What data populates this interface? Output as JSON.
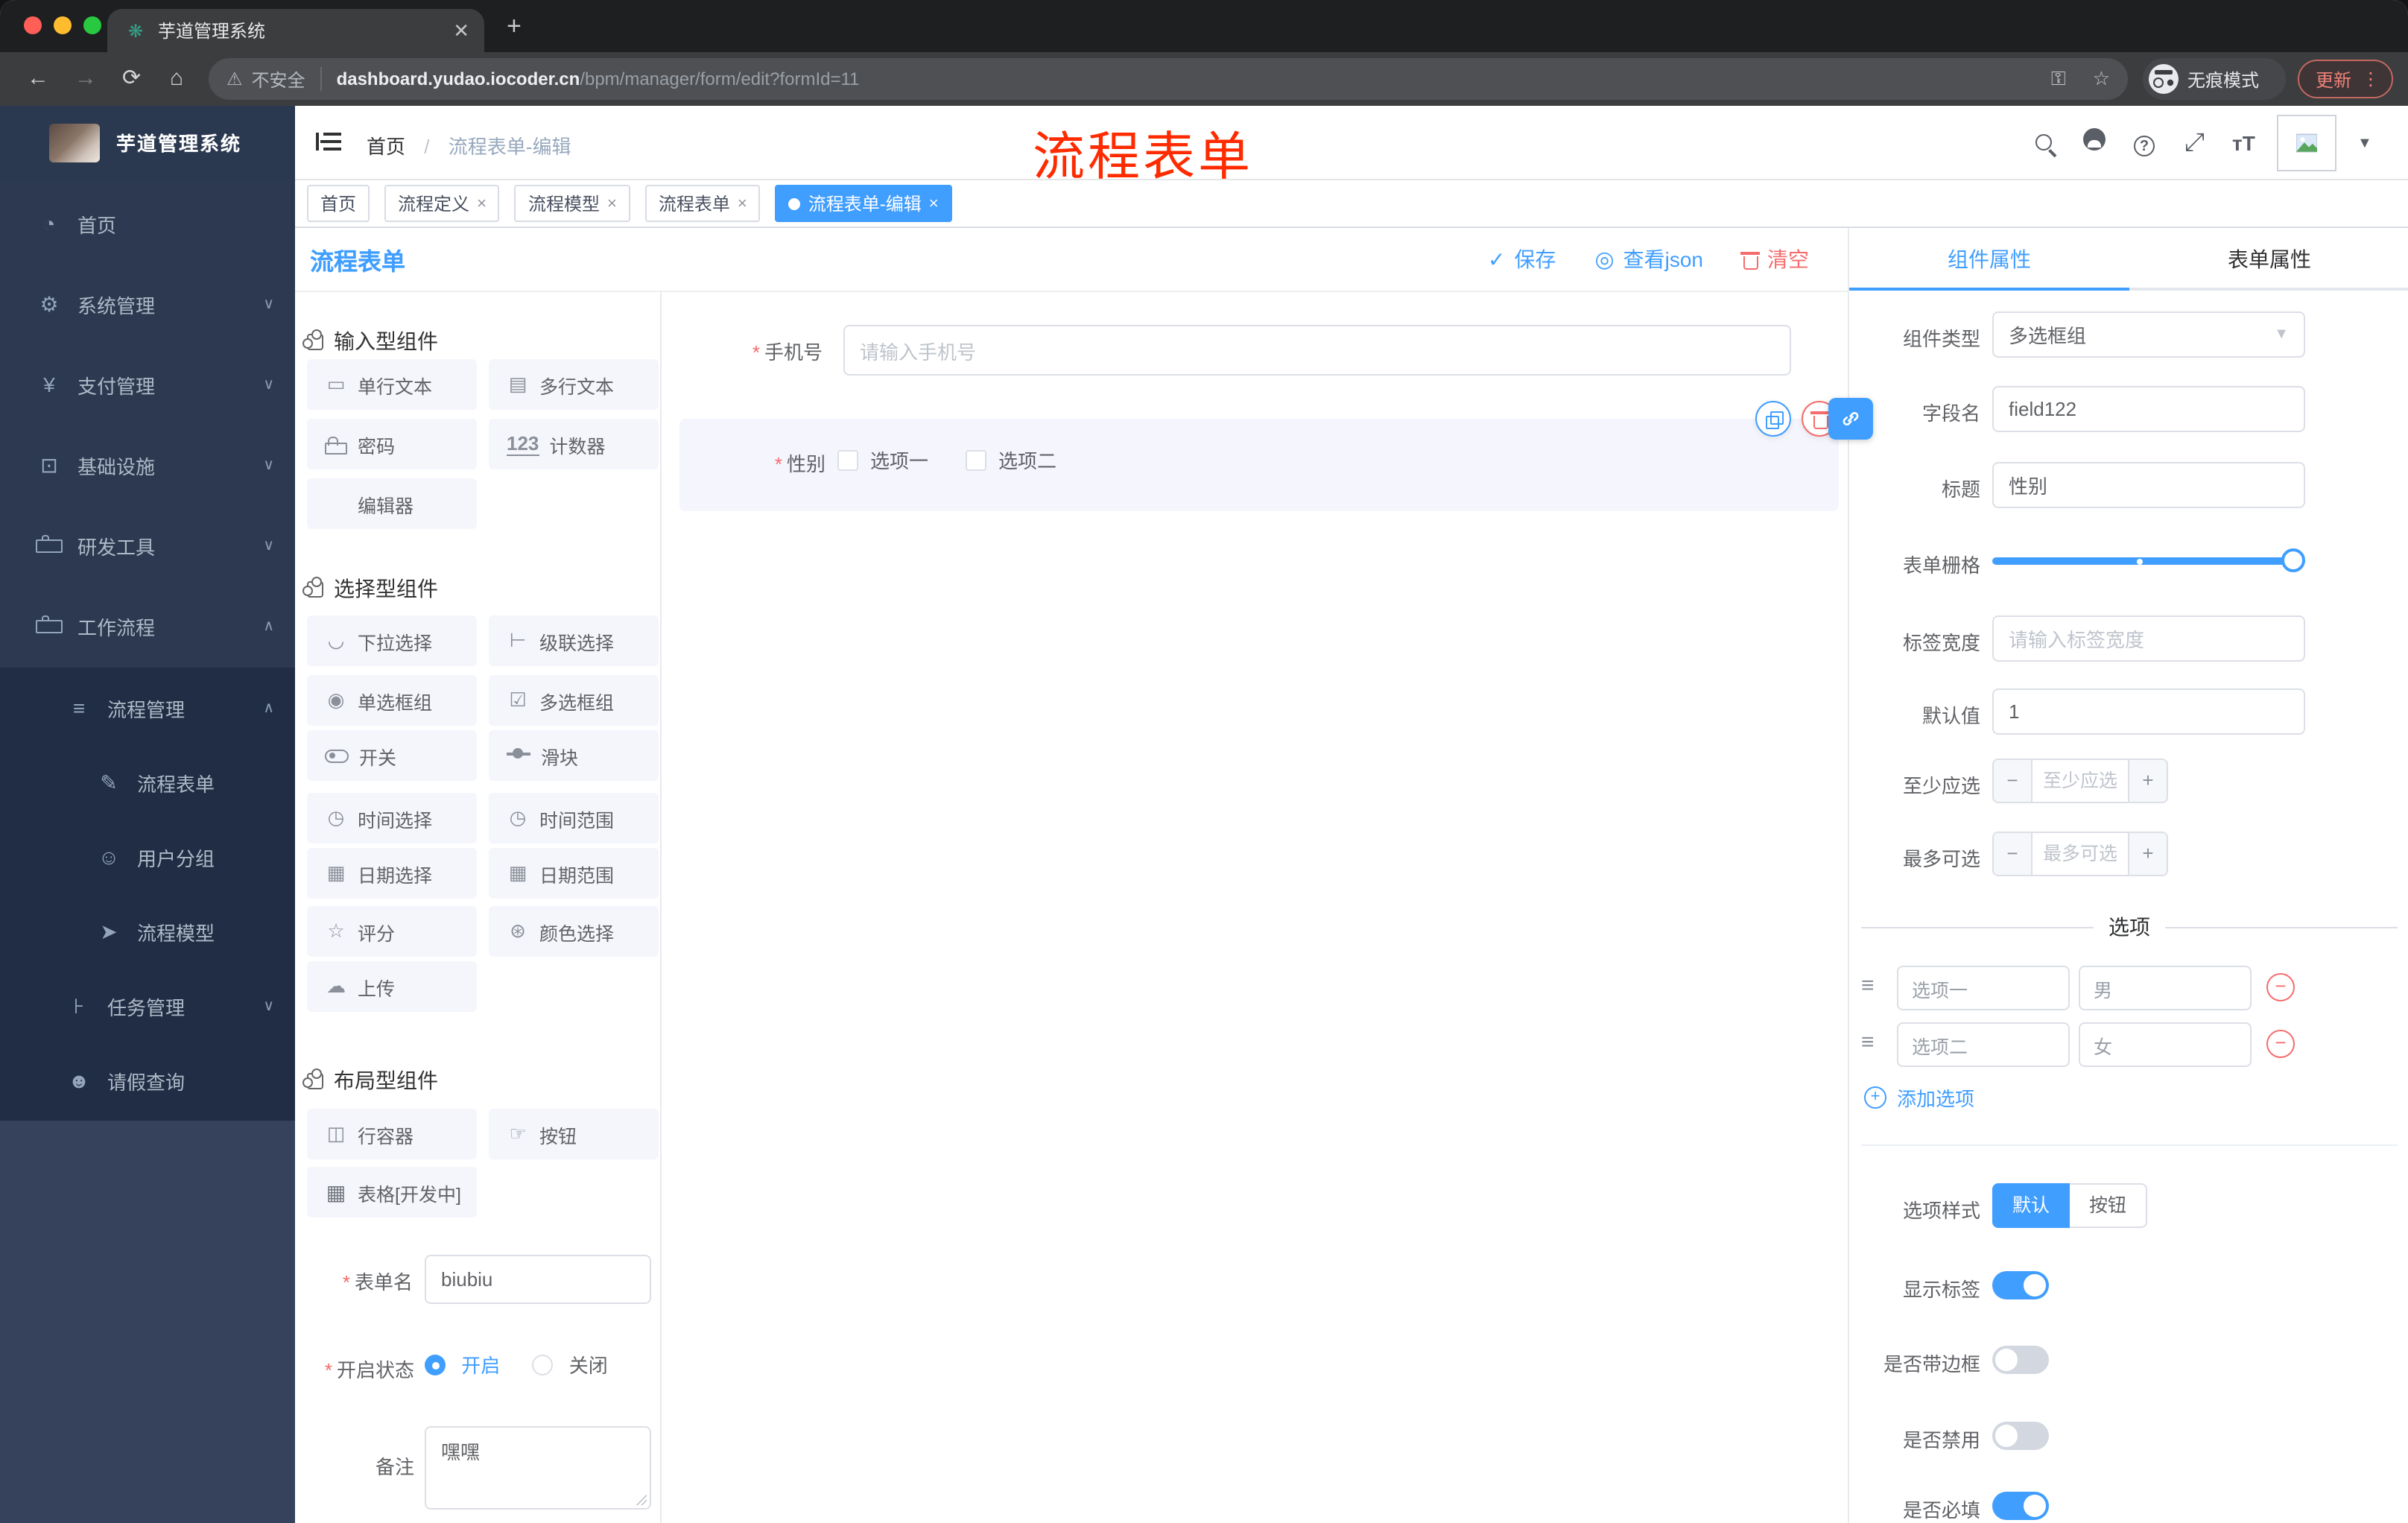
{
  "browser": {
    "tab_title": "芋道管理系统",
    "security": "不安全",
    "url_host": "dashboard.yudao.iocoder.cn",
    "url_path": "/bpm/manager/form/edit?formId=11",
    "incognito": "无痕模式",
    "update": "更新"
  },
  "sidebar": {
    "title": "芋道管理系统",
    "menu": [
      {
        "icon": "dashboard-icon",
        "label": "首页",
        "level": 0,
        "chevron": ""
      },
      {
        "icon": "gear-icon",
        "label": "系统管理",
        "level": 0,
        "chevron": "down"
      },
      {
        "icon": "yen-icon",
        "label": "支付管理",
        "level": 0,
        "chevron": "down"
      },
      {
        "icon": "monitor-icon",
        "label": "基础设施",
        "level": 0,
        "chevron": "down"
      },
      {
        "icon": "toolbox-icon",
        "label": "研发工具",
        "level": 0,
        "chevron": "down"
      },
      {
        "icon": "briefcase-icon",
        "label": "工作流程",
        "level": 0,
        "chevron": "up"
      },
      {
        "icon": "list-icon",
        "label": "流程管理",
        "level": 1,
        "chevron": "up"
      },
      {
        "icon": "doc-edit-icon",
        "label": "流程表单",
        "level": 2,
        "chevron": ""
      },
      {
        "icon": "users-icon",
        "label": "用户分组",
        "level": 2,
        "chevron": ""
      },
      {
        "icon": "paper-plane-icon",
        "label": "流程模型",
        "level": 2,
        "chevron": ""
      },
      {
        "icon": "tree-icon",
        "label": "任务管理",
        "level": 1,
        "chevron": "down"
      },
      {
        "icon": "user-icon",
        "label": "请假查询",
        "level": 1,
        "chevron": ""
      }
    ]
  },
  "navbar": {
    "breadcrumb_home": "首页",
    "breadcrumb_current": "流程表单-编辑",
    "annotation": "流程表单"
  },
  "tags": [
    {
      "label": "首页",
      "closable": false,
      "active": false
    },
    {
      "label": "流程定义",
      "closable": true,
      "active": false
    },
    {
      "label": "流程模型",
      "closable": true,
      "active": false
    },
    {
      "label": "流程表单",
      "closable": true,
      "active": false
    },
    {
      "label": "流程表单-编辑",
      "closable": true,
      "active": true
    }
  ],
  "designer": {
    "title": "流程表单",
    "save": "保存",
    "view_json": "查看json",
    "clear": "清空"
  },
  "components": {
    "groups": [
      {
        "title": "输入型组件",
        "items": [
          {
            "icon": "input-icon",
            "label": "单行文本"
          },
          {
            "icon": "textarea-icon",
            "label": "多行文本"
          },
          {
            "icon": "lock-icon",
            "label": "密码"
          },
          {
            "icon": "counter-icon",
            "label": "计数器"
          },
          {
            "icon": "none",
            "label": "编辑器"
          }
        ]
      },
      {
        "title": "选择型组件",
        "items": [
          {
            "icon": "select-icon",
            "label": "下拉选择"
          },
          {
            "icon": "cascader-icon",
            "label": "级联选择"
          },
          {
            "icon": "radio-icon",
            "label": "单选框组"
          },
          {
            "icon": "checkbox-icon",
            "label": "多选框组"
          },
          {
            "icon": "switch-icon",
            "label": "开关"
          },
          {
            "icon": "slider-icon",
            "label": "滑块"
          },
          {
            "icon": "clock-icon",
            "label": "时间选择"
          },
          {
            "icon": "time-range-icon",
            "label": "时间范围"
          },
          {
            "icon": "calendar-icon",
            "label": "日期选择"
          },
          {
            "icon": "date-range-icon",
            "label": "日期范围"
          },
          {
            "icon": "star-icon",
            "label": "评分"
          },
          {
            "icon": "palette-icon",
            "label": "颜色选择"
          },
          {
            "icon": "cloud-upload-icon",
            "label": "上传"
          }
        ]
      },
      {
        "title": "布局型组件",
        "items": [
          {
            "icon": "columns-icon",
            "label": "行容器"
          },
          {
            "icon": "click-icon",
            "label": "按钮"
          },
          {
            "icon": "table-icon",
            "label": "表格[开发中]"
          }
        ]
      }
    ]
  },
  "form_meta": {
    "name_label": "表单名",
    "name_value": "biubiu",
    "status_label": "开启状态",
    "status_on": "开启",
    "status_off": "关闭",
    "remark_label": "备注",
    "remark_value": "嘿嘿"
  },
  "canvas": {
    "phone_label": "手机号",
    "phone_placeholder": "请输入手机号",
    "gender_label": "性别",
    "gender_options": [
      "选项一",
      "选项二"
    ]
  },
  "props": {
    "tab_component": "组件属性",
    "tab_form": "表单属性",
    "component_type_label": "组件类型",
    "component_type_value": "多选框组",
    "field_name_label": "字段名",
    "field_name_value": "field122",
    "title_label": "标题",
    "title_value": "性别",
    "grid_label": "表单栅格",
    "label_width_label": "标签宽度",
    "label_width_placeholder": "请输入标签宽度",
    "default_label": "默认值",
    "default_value": "1",
    "min_label": "至少应选",
    "min_placeholder": "至少应选",
    "max_label": "最多可选",
    "max_placeholder": "最多可选",
    "options_divider": "选项",
    "options": [
      {
        "label": "选项一",
        "value": "男"
      },
      {
        "label": "选项二",
        "value": "女"
      }
    ],
    "add_option": "添加选项",
    "option_style_label": "选项样式",
    "option_style_on": "默认",
    "option_style_off": "按钮",
    "switches": [
      {
        "label": "显示标签",
        "on": true
      },
      {
        "label": "是否带边框",
        "on": false
      },
      {
        "label": "是否禁用",
        "on": false
      },
      {
        "label": "是否必填",
        "on": true
      }
    ]
  },
  "colors": {
    "primary": "#409eff",
    "danger": "#f56c6c",
    "annotation": "#ff2b00"
  }
}
